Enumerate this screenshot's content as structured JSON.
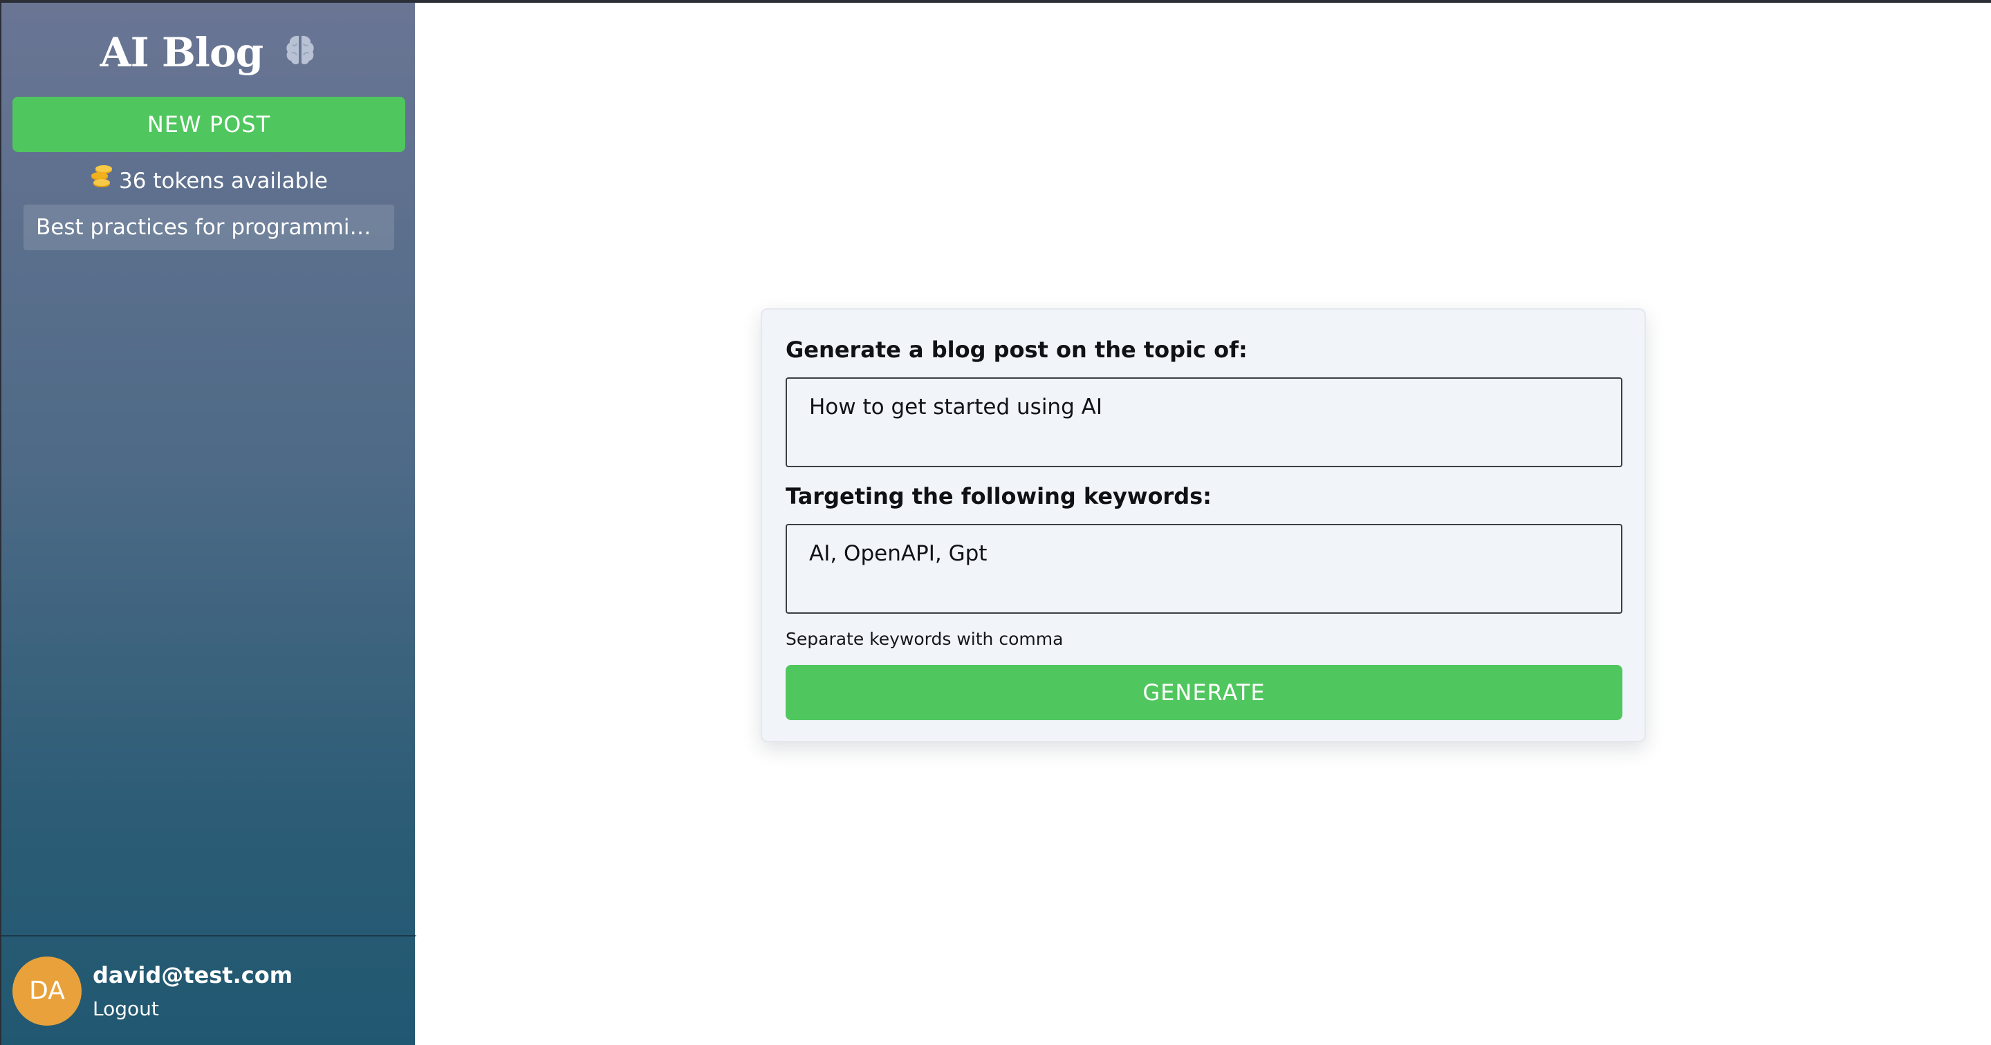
{
  "sidebar": {
    "logo_text": "AI Blog",
    "logo_icon": "brain-icon",
    "new_post_label": "NEW POST",
    "tokens_icon": "coins-icon",
    "tokens_text": "36 tokens available",
    "posts": [
      {
        "title": "Best practices for programming ..."
      }
    ],
    "user": {
      "initials": "DA",
      "email": "david@test.com",
      "logout_label": "Logout"
    }
  },
  "form": {
    "topic_label": "Generate a blog post on the topic of:",
    "topic_value": "How to get started using AI",
    "keywords_label": "Targeting the following keywords:",
    "keywords_value": "AI, OpenAPI, Gpt",
    "keywords_hint": "Separate keywords with comma",
    "generate_label": "GENERATE"
  },
  "colors": {
    "accent_green": "#50c65e",
    "avatar_orange": "#e9a23b",
    "sidebar_top": "#6a7594",
    "sidebar_bottom": "#215871"
  }
}
